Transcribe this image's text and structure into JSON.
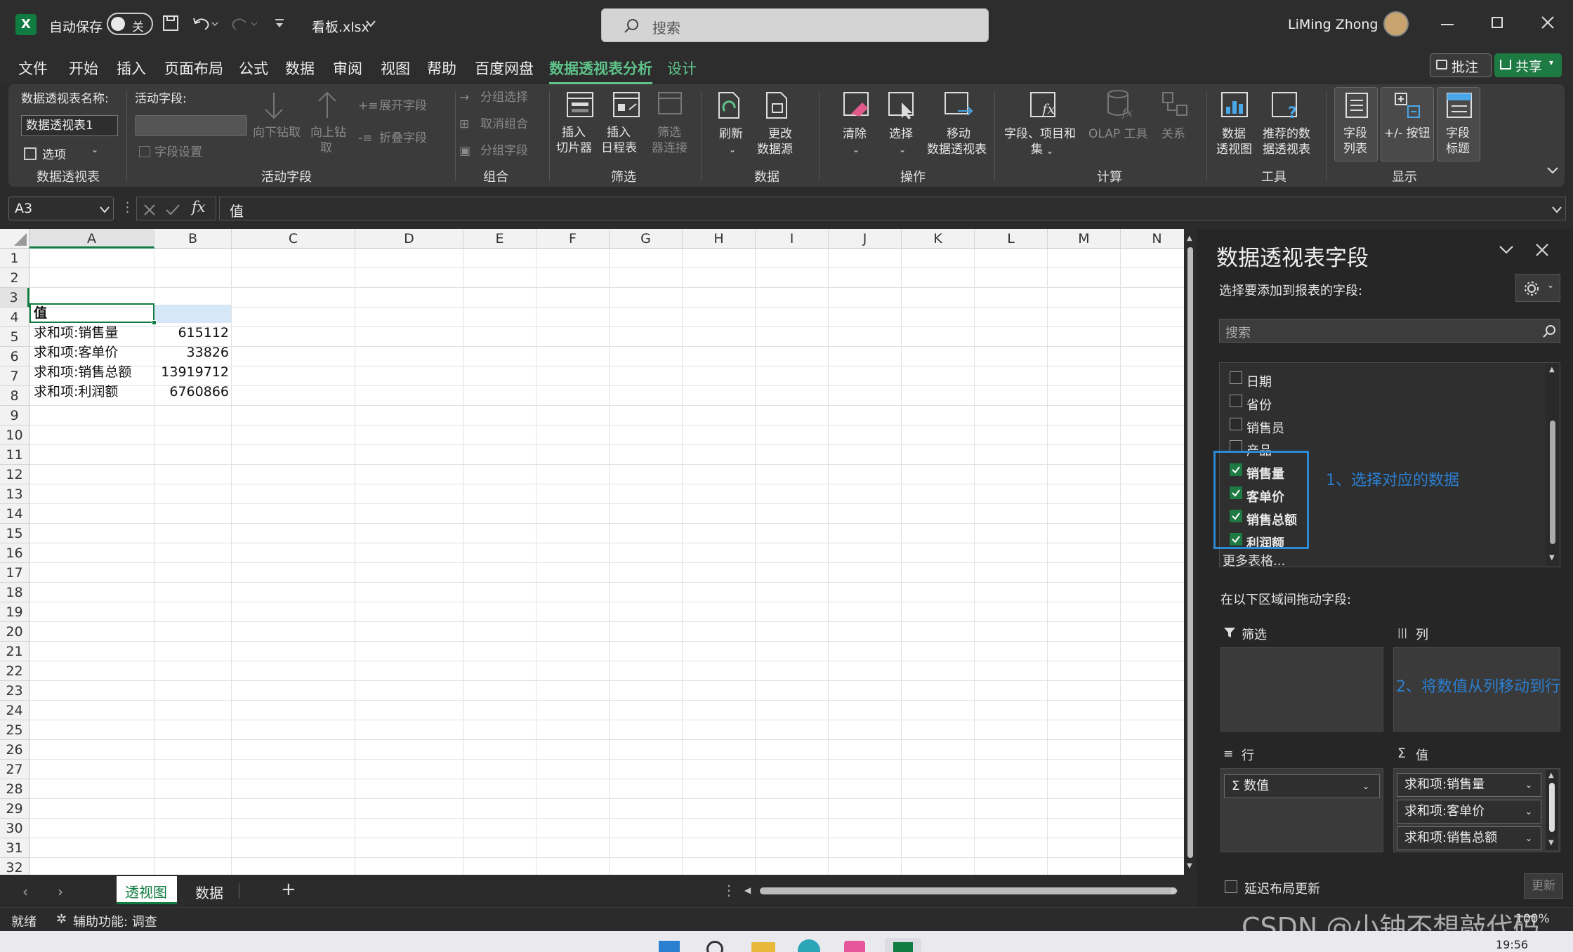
{
  "titlebar": {
    "autosave_label": "自动保存",
    "autosave_state": "关",
    "filename": "看板.xlsx",
    "search_placeholder": "搜索",
    "user_name": "LiMing Zhong"
  },
  "menu": {
    "items": [
      "文件",
      "开始",
      "插入",
      "页面布局",
      "公式",
      "数据",
      "审阅",
      "视图",
      "帮助",
      "百度网盘",
      "数据透视表分析",
      "设计"
    ],
    "active": "数据透视表分析",
    "comment_btn": "批注",
    "share_btn": "共享"
  },
  "ribbon": {
    "pt_name_label": "数据透视表名称:",
    "pt_name_value": "数据透视表1",
    "options_label": "选项",
    "group_pivottable": "数据透视表",
    "active_field_label": "活动字段:",
    "field_settings": "字段设置",
    "drill_down": "向下钻取",
    "drill_up_1": "向上钻",
    "drill_up_2": "取",
    "expand_field": "展开字段",
    "collapse_field": "折叠字段",
    "group_active_field": "活动字段",
    "group_selection": "分组选择",
    "ungroup": "取消组合",
    "group_field": "分组字段",
    "group_group": "组合",
    "insert_slicer_1": "插入",
    "insert_slicer_2": "切片器",
    "insert_timeline_1": "插入",
    "insert_timeline_2": "日程表",
    "filter_conn_1": "筛选",
    "filter_conn_2": "器连接",
    "group_filter": "筛选",
    "refresh": "刷新",
    "change_source_1": "更改",
    "change_source_2": "数据源",
    "group_data": "数据",
    "clear": "清除",
    "select": "选择",
    "move_pt_1": "移动",
    "move_pt_2": "数据透视表",
    "group_actions": "操作",
    "fields_items_1": "字段、项目和",
    "fields_items_2": "集",
    "olap_tools": "OLAP 工具",
    "relationships": "关系",
    "group_calc": "计算",
    "pivotchart_1": "数据",
    "pivotchart_2": "透视图",
    "recommended_1": "推荐的数",
    "recommended_2": "据透视表",
    "group_tools": "工具",
    "field_list_1": "字段",
    "field_list_2": "列表",
    "pm_buttons": "+/- 按钮",
    "field_headers_1": "字段",
    "field_headers_2": "标题",
    "group_show": "显示"
  },
  "formula_bar": {
    "name_box": "A3",
    "fx": "fx",
    "content": "值"
  },
  "grid": {
    "columns": [
      "A",
      "B",
      "C",
      "D",
      "E",
      "F",
      "G",
      "H",
      "I",
      "J",
      "K",
      "L",
      "M",
      "N"
    ],
    "rows": [
      "1",
      "2",
      "3",
      "4",
      "5",
      "6",
      "7",
      "8",
      "9",
      "10",
      "11",
      "12",
      "13",
      "14",
      "15",
      "16",
      "17",
      "18",
      "19",
      "20",
      "21",
      "22",
      "23",
      "24",
      "25",
      "26",
      "27",
      "28",
      "29",
      "30",
      "31",
      "32"
    ],
    "header_cell": "值",
    "data": [
      {
        "label": "求和项:销售量",
        "value": "615112"
      },
      {
        "label": "求和项:客单价",
        "value": "33826"
      },
      {
        "label": "求和项:销售总额",
        "value": "13919712"
      },
      {
        "label": "求和项:利润额",
        "value": "6760866"
      }
    ]
  },
  "pane": {
    "title": "数据透视表字段",
    "choose_label": "选择要添加到报表的字段:",
    "search_placeholder": "搜索",
    "fields": [
      {
        "name": "日期",
        "checked": false
      },
      {
        "name": "省份",
        "checked": false
      },
      {
        "name": "销售员",
        "checked": false
      },
      {
        "name": "产品",
        "checked": false
      },
      {
        "name": "销售量",
        "checked": true
      },
      {
        "name": "客单价",
        "checked": true
      },
      {
        "name": "销售总额",
        "checked": true
      },
      {
        "name": "利润额",
        "checked": true
      }
    ],
    "more_tables": "更多表格...",
    "drag_label": "在以下区域间拖动字段:",
    "filter_label": "筛选",
    "columns_label": "列",
    "rows_label": "行",
    "values_label": "值",
    "rows_item": "数值",
    "values_items": [
      "求和项:销售量",
      "求和项:客单价",
      "求和项:销售总额"
    ],
    "defer_label": "延迟布局更新",
    "update_btn": "更新"
  },
  "annotations": {
    "note1": "1、选择对应的数据",
    "note2": "2、将数值从列移动到行"
  },
  "sheets": {
    "tabs": [
      "透视图",
      "数据"
    ],
    "active": "透视图",
    "add": "+"
  },
  "status": {
    "ready": "就绪",
    "accessibility": "辅助功能: 调查",
    "watermark": "CSDN @小钟不想敲代码",
    "zoom": "100%",
    "time": "19:56"
  },
  "colors": {
    "accent": "#5fc38a",
    "excel_green": "#107c41",
    "annotation": "#2b7fd1"
  }
}
